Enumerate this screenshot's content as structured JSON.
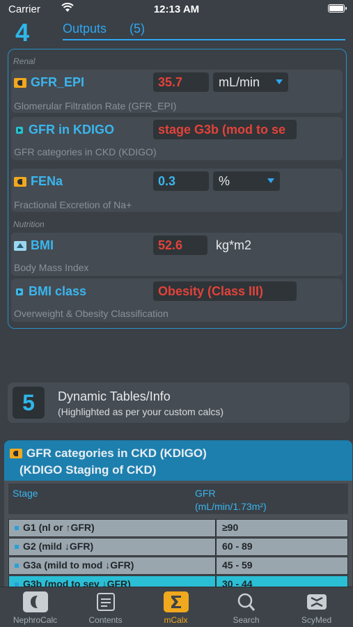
{
  "status_bar": {
    "carrier": "Carrier",
    "time": "12:13 AM"
  },
  "section4": {
    "number": "4",
    "title": "Outputs",
    "count": "(5)"
  },
  "groups": {
    "renal": "Renal",
    "nutrition": "Nutrition"
  },
  "outputs": [
    {
      "name": "GFR_EPI",
      "value": "35.7",
      "unit": "mL/min",
      "description": "Glomerular Filtration Rate (GFR_EPI)"
    },
    {
      "name": "GFR in KDIGO",
      "value": "stage G3b (mod to se",
      "description": "GFR categories in CKD (KDIGO)"
    },
    {
      "name": "FENa",
      "value": "0.3",
      "unit": "%",
      "description": "Fractional Excretion of Na+"
    },
    {
      "name": "BMI",
      "value": "52.6",
      "unit": "kg*m2",
      "description": "Body Mass Index"
    },
    {
      "name": "BMI class",
      "value": "Obesity (Class III)",
      "description": "Overweight & Obesity Classification"
    }
  ],
  "section5": {
    "number": "5",
    "title": "Dynamic Tables/Info",
    "subtitle": "(Highlighted as per your custom calcs)"
  },
  "table": {
    "title": "GFR categories in CKD (KDIGO)",
    "subtitle": "(KDIGO Staging of CKD)",
    "col_stage": "Stage",
    "col_gfr": "GFR",
    "col_gfr_unit": "(mL/min/1.73m²)",
    "rows": [
      {
        "stage": "G1 (nl or ↑GFR)",
        "gfr": "≥90"
      },
      {
        "stage": "G2 (mild ↓GFR)",
        "gfr": "60 - 89"
      },
      {
        "stage": "G3a (mild to mod ↓GFR)",
        "gfr": "45 - 59"
      },
      {
        "stage": "G3b (mod to sev ↓GFR)",
        "gfr": "30 - 44"
      }
    ]
  },
  "tabs": [
    {
      "label": "NephroCalc",
      "icon": "kidney-icon"
    },
    {
      "label": "Contents",
      "icon": "contents-icon"
    },
    {
      "label": "mCalx",
      "icon": "sigma-icon"
    },
    {
      "label": "Search",
      "icon": "search-icon"
    },
    {
      "label": "ScyMed",
      "icon": "scymed-icon"
    }
  ],
  "colors": {
    "accent": "#2fa6f0",
    "value_red": "#e2433a",
    "active_tab": "#f0a81e",
    "highlight_row": "#2bbfd6"
  }
}
